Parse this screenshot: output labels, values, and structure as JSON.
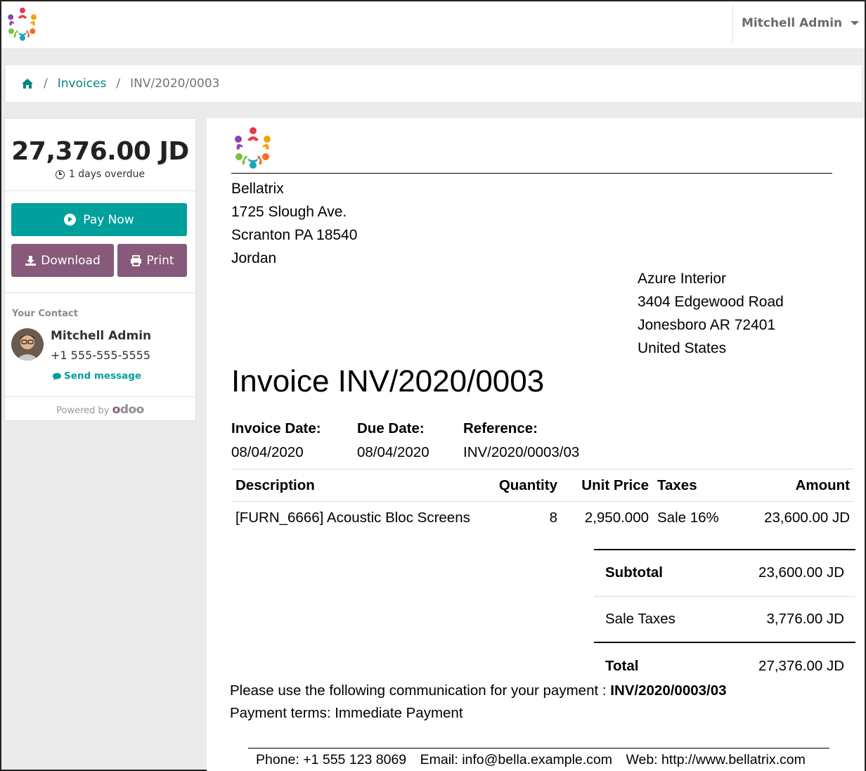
{
  "navbar": {
    "user_name": "Mitchell Admin"
  },
  "breadcrumb": {
    "invoices": "Invoices",
    "current": "INV/2020/0003"
  },
  "sidebar": {
    "amount": "27,376.00 JD",
    "overdue": "1 days overdue",
    "pay_now": "Pay Now",
    "download": "Download",
    "print": "Print",
    "contact_label": "Your Contact",
    "contact_name": "Mitchell Admin",
    "contact_phone": "+1 555-555-5555",
    "send_message": "Send message",
    "powered_by": "Powered by",
    "odoo_o": "o",
    "odoo_rest": "doo"
  },
  "invoice": {
    "company": {
      "name": "Bellatrix",
      "street": "1725 Slough Ave.",
      "city": "Scranton PA 18540",
      "country": "Jordan"
    },
    "customer": {
      "name": "Azure Interior",
      "street": "3404 Edgewood Road",
      "city": "Jonesboro AR 72401",
      "country": "United States"
    },
    "title": "Invoice INV/2020/0003",
    "invoice_date_label": "Invoice Date:",
    "invoice_date": "08/04/2020",
    "due_date_label": "Due Date:",
    "due_date": "08/04/2020",
    "reference_label": "Reference:",
    "reference": "INV/2020/0003/03",
    "columns": {
      "description": "Description",
      "quantity": "Quantity",
      "unit_price": "Unit Price",
      "taxes": "Taxes",
      "amount": "Amount"
    },
    "lines": [
      {
        "description": "[FURN_6666] Acoustic Bloc Screens",
        "quantity": "8",
        "unit_price": "2,950.000",
        "taxes": "Sale 16%",
        "amount": "23,600.00 JD"
      }
    ],
    "subtotal_label": "Subtotal",
    "subtotal": "23,600.00 JD",
    "taxes_label": "Sale Taxes",
    "taxes": "3,776.00 JD",
    "total_label": "Total",
    "total": "27,376.00 JD",
    "communication_text": "Please use the following communication for your payment : ",
    "communication_ref": "INV/2020/0003/03",
    "payment_terms": "Payment terms: Immediate Payment",
    "footer": {
      "phone": "Phone: +1 555 123 8069",
      "email": "Email: info@bella.example.com",
      "web": "Web: http://www.bellatrix.com"
    }
  },
  "colors": {
    "teal": "#00a09d",
    "purple": "#875a7b",
    "link": "#00857d"
  }
}
